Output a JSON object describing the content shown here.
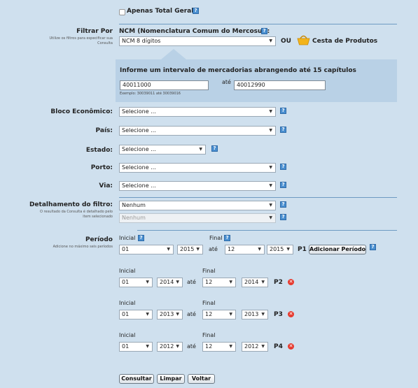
{
  "apenas": {
    "label": "Apenas Total Geral",
    "checked": false
  },
  "filtrar": {
    "label": "Filtrar Por",
    "sublabel_1": "Utilize os filtros para especificar sua",
    "sublabel_2": "Consulta",
    "heading": "NCM (Nomenclatura Comum do Mercosul):",
    "select_value": "NCM 8 dígitos",
    "ou": "OU",
    "cesta": "Cesta de Produtos"
  },
  "intervalo": {
    "heading": "Informe um intervalo de mercadorias abrangendo até 15 capítulos",
    "from": "40011000",
    "ate": "até",
    "to": "40012990",
    "exemplo": "Exemplo: 30039011 até 30039016"
  },
  "filters": [
    {
      "label": "Bloco Econômico:",
      "value": "Selecione ..."
    },
    {
      "label": "País:",
      "value": "Selecione ..."
    },
    {
      "label": "Estado:",
      "value": "Selecione ..."
    },
    {
      "label": "Porto:",
      "value": "Selecione ..."
    },
    {
      "label": "Via:",
      "value": "Selecione ..."
    }
  ],
  "detalhamento": {
    "label": "Detalhamento do filtro:",
    "sublabel_1": "O resultado da Consulta é detalhado pelo",
    "sublabel_2": "item selecionado",
    "value_1": "Nenhum",
    "value_2": "Nenhum"
  },
  "periodo": {
    "label": "Período",
    "sublabel": "Adicione no máximo seis períodos",
    "inicial": "Inicial",
    "final": "Final",
    "ate": "até",
    "add_button": "Adicionar Período",
    "rows": [
      {
        "tag": "P1",
        "m1": "01",
        "y1": "2015",
        "m2": "12",
        "y2": "2015"
      },
      {
        "tag": "P2",
        "m1": "01",
        "y1": "2014",
        "m2": "12",
        "y2": "2014"
      },
      {
        "tag": "P3",
        "m1": "01",
        "y1": "2013",
        "m2": "12",
        "y2": "2013"
      },
      {
        "tag": "P4",
        "m1": "01",
        "y1": "2012",
        "m2": "12",
        "y2": "2012"
      }
    ]
  },
  "actions": {
    "consultar": "Consultar",
    "limpar": "Limpar",
    "voltar": "Voltar"
  },
  "icons": {
    "help": "help-icon",
    "remove": "remove-icon",
    "basket": "basket-icon",
    "arrow": "dropdown-arrow-icon"
  },
  "glyphs": {
    "help": "?",
    "remove": "✕",
    "arrow": "▼"
  },
  "colors": {
    "background": "#cfe0ee",
    "panel": "#b9d1e6",
    "help": "#4a8fd0",
    "remove": "#e63a2e",
    "basket": "#f3b41b"
  }
}
